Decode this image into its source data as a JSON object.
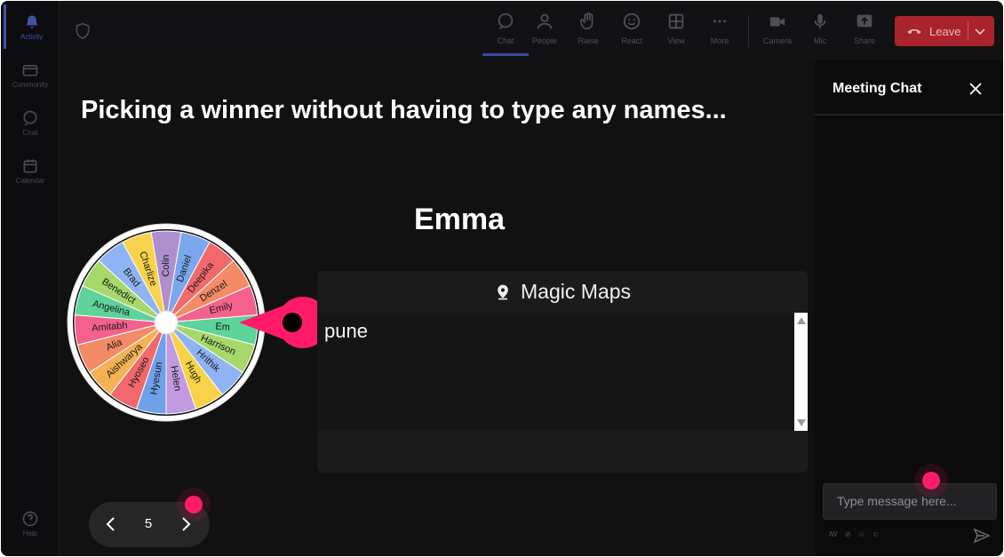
{
  "rail": {
    "items": [
      {
        "label": "Activity",
        "icon": "bell-icon"
      },
      {
        "label": "Community",
        "icon": "community-icon"
      },
      {
        "label": "Chat",
        "icon": "chat-icon"
      },
      {
        "label": "Calendar",
        "icon": "calendar-icon"
      }
    ],
    "help_label": "Help"
  },
  "toolbar": {
    "items": [
      {
        "label": "Chat",
        "icon": "chat-icon"
      },
      {
        "label": "People",
        "icon": "people-icon"
      },
      {
        "label": "Raise",
        "icon": "raise-hand-icon"
      },
      {
        "label": "React",
        "icon": "smile-icon"
      },
      {
        "label": "View",
        "icon": "view-grid-icon"
      },
      {
        "label": "More",
        "icon": "more-icon"
      },
      {
        "label": "Camera",
        "icon": "camera-icon"
      },
      {
        "label": "Mic",
        "icon": "mic-icon"
      },
      {
        "label": "Share",
        "icon": "share-icon"
      }
    ],
    "leave_label": "Leave"
  },
  "stage": {
    "title": "Picking a winner without having to type any names...",
    "winner": "Emma",
    "wheel_names": [
      "Colin",
      "Daniel",
      "Deepika",
      "Denzel",
      "Emily",
      "Em",
      "Harrison",
      "Hrithik",
      "Hugh",
      "Helen",
      "Hyesun",
      "Hyoseo",
      "Aishwarya",
      "Alia",
      "Amitabh",
      "Angelina",
      "Benedict",
      "Brad",
      "Charlize"
    ],
    "card": {
      "title": "Magic Maps",
      "text": "pune"
    },
    "pager": {
      "page": "5"
    }
  },
  "chat": {
    "title": "Meeting Chat",
    "placeholder": "Type message here..."
  },
  "colors": {
    "accent_pink": "#ff1a6a",
    "leave_red": "#a8232b",
    "active_blue": "#3f4fa8"
  }
}
